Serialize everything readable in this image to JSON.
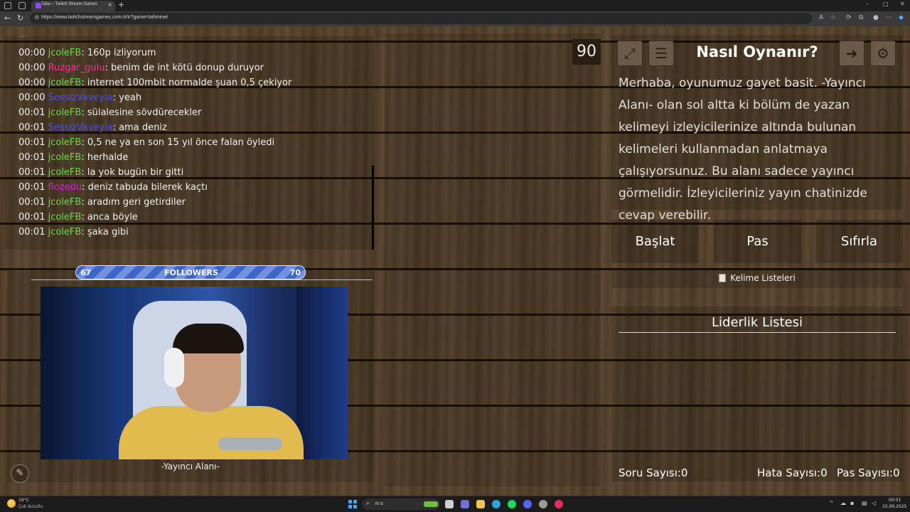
{
  "browser": {
    "tab_title": "Tabu – Twitch Stream Games",
    "url": "https://www.twitchstreamgames.com.tr/tr?game=tahminet",
    "new_tab": "+",
    "tab_close": "×"
  },
  "chat": {
    "partial_top": "...",
    "messages": [
      {
        "time": "00:00",
        "user": "jcoleFB",
        "color": "#62dc4a",
        "text": ": 160p izliyorum"
      },
      {
        "time": "00:00",
        "user": "Ruzgar_gulu",
        "color": "#ff2d8e",
        "text": ": benim de int kötü donup duruyor"
      },
      {
        "time": "00:00",
        "user": "jcoleFB",
        "color": "#62dc4a",
        "text": ": internet 100mbit normalde şuan 0,5 çekiyor"
      },
      {
        "time": "00:00",
        "user": "SessizVaveyla",
        "color": "#4b4fe6",
        "text": ": yeah"
      },
      {
        "time": "00:01",
        "user": "jcoleFB",
        "color": "#62dc4a",
        "text": ": sülalesine sövdürecekler"
      },
      {
        "time": "00:01",
        "user": "SessizVaveyla",
        "color": "#4b4fe6",
        "text": ": ama deniz"
      },
      {
        "time": "00:01",
        "user": "jcoleFB",
        "color": "#62dc4a",
        "text": ": 0,5 ne ya en son 15 yıl önce falan öyledi"
      },
      {
        "time": "00:01",
        "user": "jcoleFB",
        "color": "#62dc4a",
        "text": ": herhalde"
      },
      {
        "time": "00:01",
        "user": "jcoleFB",
        "color": "#62dc4a",
        "text": ": la yok bugün bir gitti"
      },
      {
        "time": "00:01",
        "user": "flozedu",
        "color": "#d91fd9",
        "text": ": deniz tabuda bilerek kaçtı"
      },
      {
        "time": "00:01",
        "user": "jcoleFB",
        "color": "#62dc4a",
        "text": ": aradım geri getirdiler"
      },
      {
        "time": "00:01",
        "user": "jcoleFB",
        "color": "#62dc4a",
        "text": ": anca böyle"
      },
      {
        "time": "00:01",
        "user": "jcoleFB",
        "color": "#62dc4a",
        "text": ": şaka gibi"
      }
    ]
  },
  "followers": {
    "current": "67",
    "label": "FOLLOWERS",
    "goal": "70"
  },
  "streamer": {
    "label": "-Yayıncı Alanı-"
  },
  "timer": "90",
  "how_to": {
    "title": "Nasıl Oynanır?",
    "text": "Merhaba, oyunumuz gayet basit. -Yayıncı Alanı- olan sol altta ki bölüm de yazan kelimeyi izleyicilerinize altında bulunan kelimeleri kullanmadan anlatmaya çalışıyorsunuz. Bu alanı sadece yayıncı görmelidir. İzleyicileriniz yayın chatinizde cevap verebilir."
  },
  "buttons": {
    "start": "Başlat",
    "pass": "Pas",
    "reset": "Sıfırla"
  },
  "word_lists": "Kelime Listeleri",
  "leaderboard": {
    "title": "Liderlik Listesi",
    "question_count": "Soru Sayısı:0",
    "error_count": "Hata Sayısı:0",
    "pass_count": "Pas Sayısı:0"
  },
  "taskbar": {
    "weather_temp": "19°C",
    "weather_desc": "Çok bulutlu",
    "search_placeholder": "Ara",
    "time": "00:01",
    "date": "15.09.2025"
  }
}
